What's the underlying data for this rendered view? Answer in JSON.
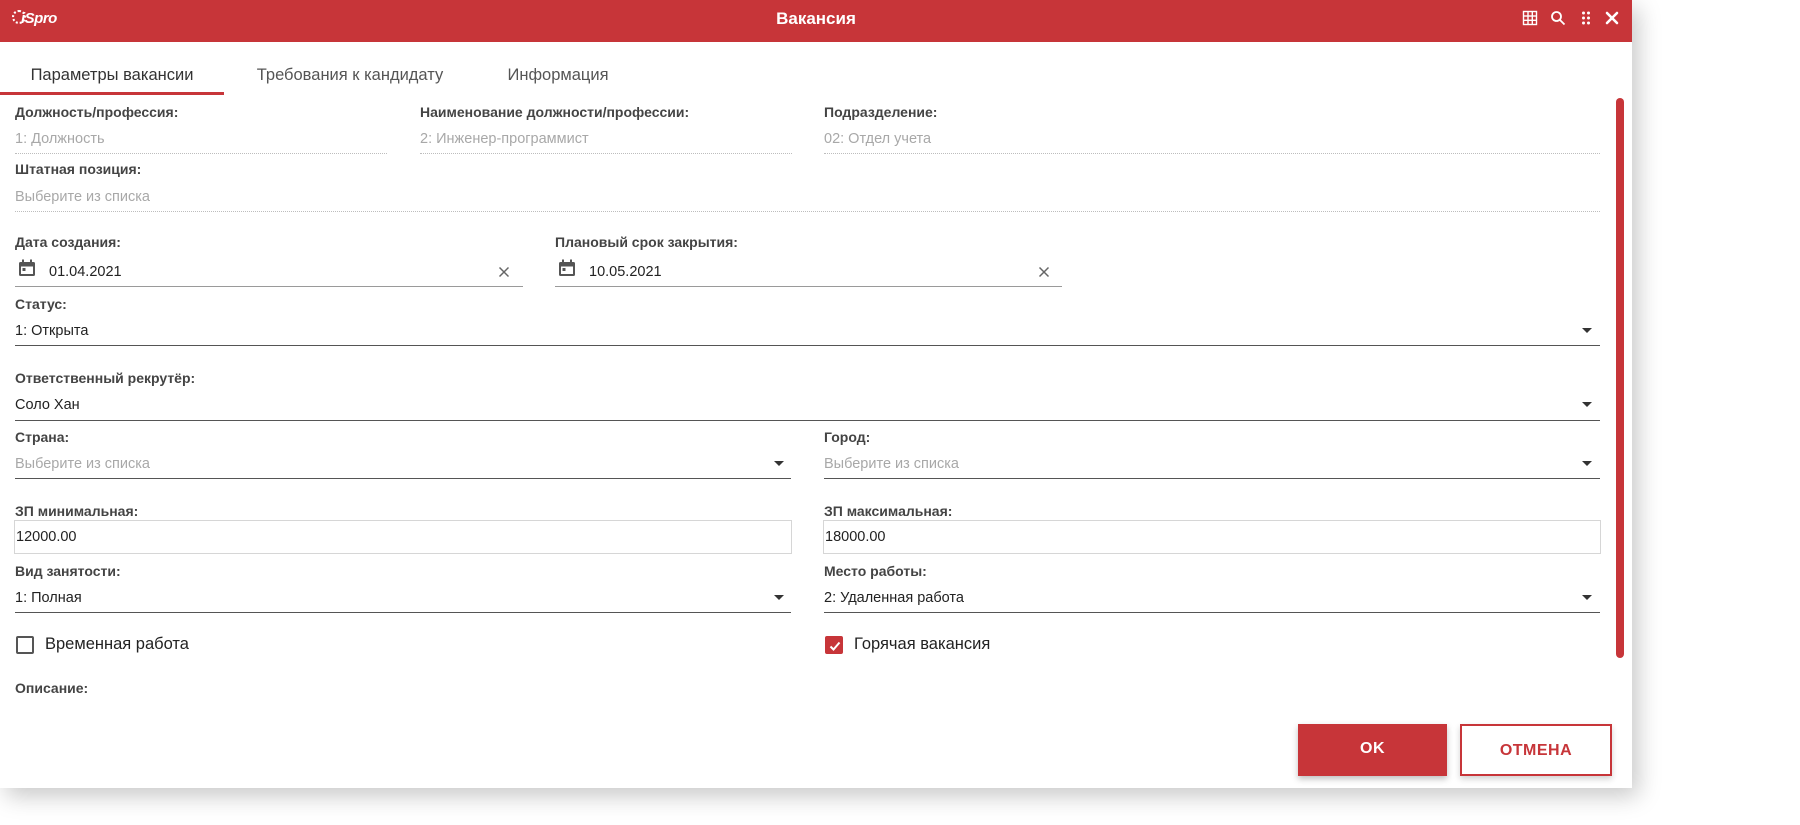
{
  "window": {
    "title": "Вакансия",
    "logo_text": "iSpro"
  },
  "tabs": [
    {
      "label": "Параметры вакансии",
      "active": true
    },
    {
      "label": "Требования к кандидату",
      "active": false
    },
    {
      "label": "Информация",
      "active": false
    }
  ],
  "fields": {
    "position": {
      "label": "Должность/профессия:",
      "value": "1: Должность"
    },
    "position_name": {
      "label": "Наименование должности/профессии:",
      "value": "2: Инженер-программист"
    },
    "department": {
      "label": "Подразделение:",
      "value": "02: Отдел учета"
    },
    "staff_position": {
      "label": "Штатная позиция:",
      "placeholder": "Выберите из списка"
    },
    "created_date": {
      "label": "Дата создания:",
      "value": "01.04.2021"
    },
    "planned_close": {
      "label": "Плановый срок закрытия:",
      "value": "10.05.2021"
    },
    "status": {
      "label": "Статус:",
      "value": "1: Открыта"
    },
    "recruiter": {
      "label": "Ответственный рекрутёр:",
      "value": "Соло Хан"
    },
    "country": {
      "label": "Страна:",
      "placeholder": "Выберите из списка"
    },
    "city": {
      "label": "Город:",
      "placeholder": "Выберите из списка"
    },
    "salary_min": {
      "label": "ЗП минимальная:",
      "value": "12000.00"
    },
    "salary_max": {
      "label": "ЗП максимальная:",
      "value": "18000.00"
    },
    "employment_type": {
      "label": "Вид занятости:",
      "value": "1: Полная"
    },
    "workplace": {
      "label": "Место работы:",
      "value": "2: Удаленная работа"
    },
    "description": {
      "label": "Описание:"
    }
  },
  "checkboxes": {
    "temporary": {
      "label": "Временная работа",
      "checked": false
    },
    "hot": {
      "label": "Горячая вакансия",
      "checked": true
    }
  },
  "buttons": {
    "ok": "OK",
    "cancel": "ОТМЕНА"
  },
  "colors": {
    "accent": "#c73539"
  }
}
